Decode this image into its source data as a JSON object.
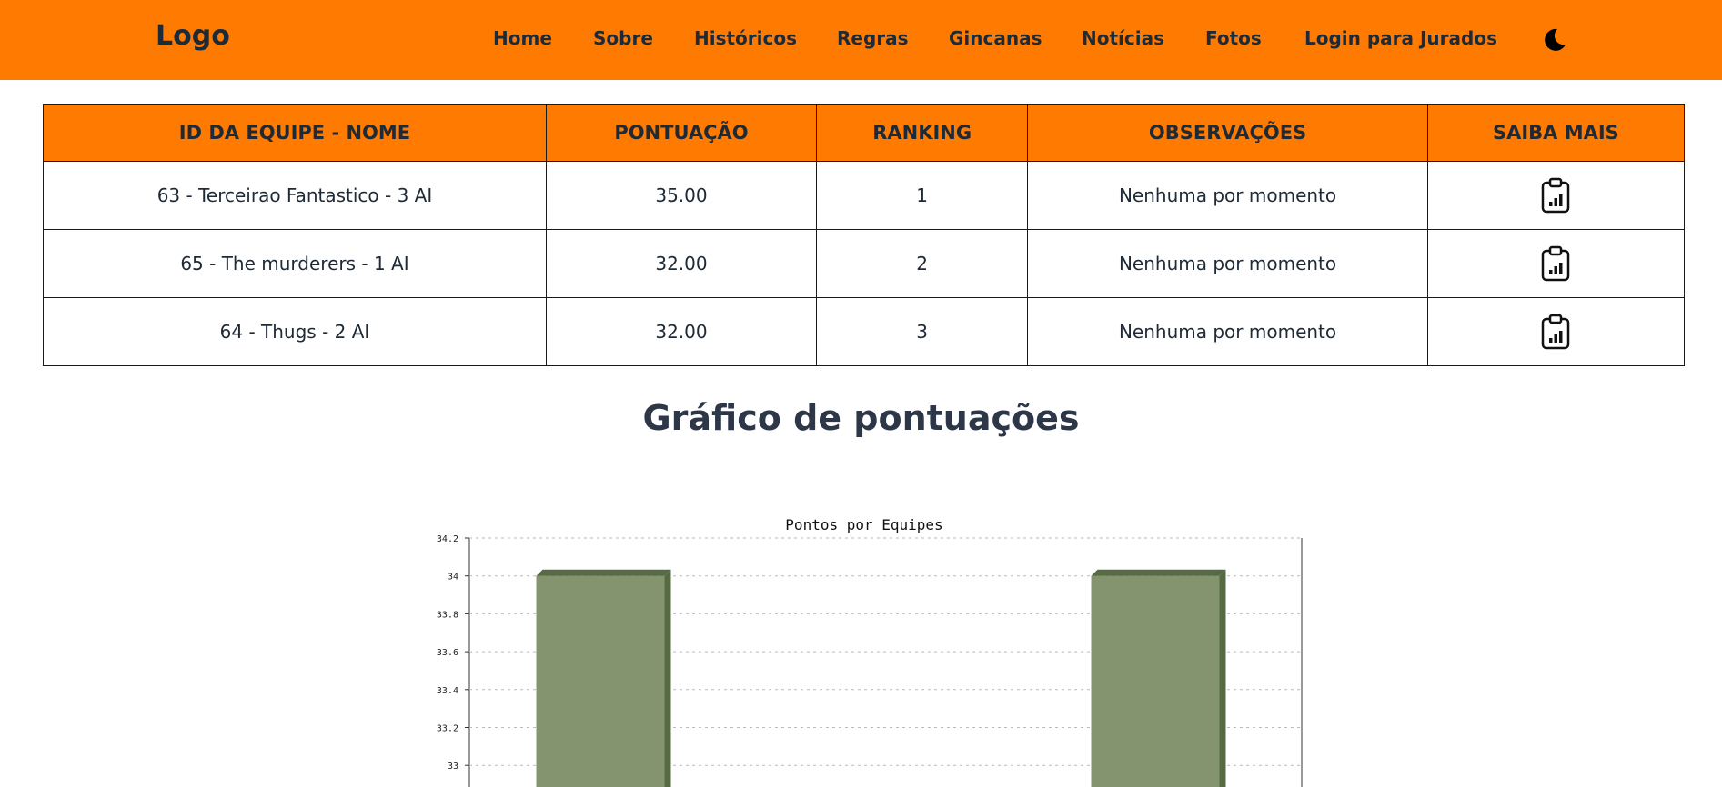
{
  "header": {
    "logo": "Logo",
    "nav": [
      "Home",
      "Sobre",
      "Históricos",
      "Regras",
      "Gincanas",
      "Notícias",
      "Fotos",
      "Login para Jurados"
    ],
    "theme_toggle_icon": "moon-icon"
  },
  "table": {
    "headers": [
      "ID DA EQUIPE - NOME",
      "PONTUAÇÃO",
      "RANKING",
      "OBSERVAÇÕES",
      "SAIBA MAIS"
    ],
    "rows": [
      {
        "team": "63 - Terceirao Fantastico - 3 AI",
        "score": "35.00",
        "rank": "1",
        "notes": "Nenhuma por momento",
        "more_icon": "clipboard-chart-icon"
      },
      {
        "team": "65 - The murderers - 1 AI",
        "score": "32.00",
        "rank": "2",
        "notes": "Nenhuma por momento",
        "more_icon": "clipboard-chart-icon"
      },
      {
        "team": "64 - Thugs - 2 AI",
        "score": "32.00",
        "rank": "3",
        "notes": "Nenhuma por momento",
        "more_icon": "clipboard-chart-icon"
      }
    ]
  },
  "section": {
    "title": "Gráfico de pontuações"
  },
  "colors": {
    "header_bg": "#ff7a00",
    "bar_front": "#84946f",
    "bar_side": "#566b43"
  },
  "chart_data": {
    "type": "bar",
    "title": "Pontos por Equipes",
    "categories": [
      "",
      ""
    ],
    "values": [
      34,
      34
    ],
    "yticks": [
      "34.2",
      "34",
      "33.8",
      "33.6",
      "33.4",
      "33.2",
      "33"
    ],
    "ylim": [
      33,
      34.2
    ],
    "grid": true,
    "xlabel": "",
    "ylabel": ""
  }
}
